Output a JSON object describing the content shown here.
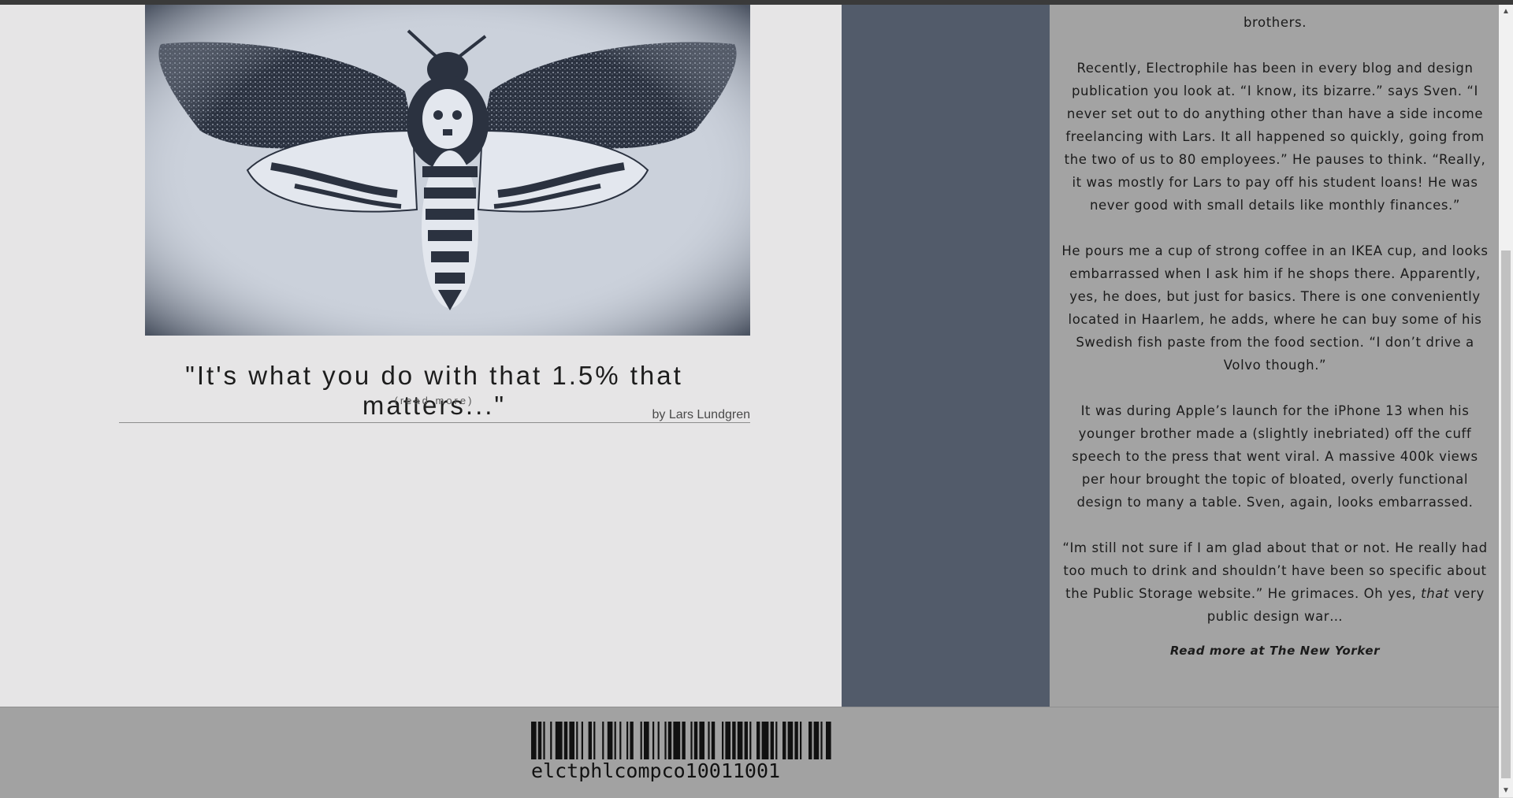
{
  "feature": {
    "quote": "\"It's what you do with that 1.5% that matters...\"",
    "read_more": "(read more)",
    "byline": "by Lars Lundgren"
  },
  "article": {
    "paragraphs": [
      "brothers.",
      "Recently, Electrophile has been in every blog and design publication you look at. “I know, its bizarre.” says Sven. “I never set out to do anything other than have a side income freelancing with Lars. It all happened so quickly, going from the two of us to 80 employees.” He pauses to think. “Really, it was mostly for Lars to pay off his student loans! He was never good with small details like monthly finances.”",
      "He pours me a cup of strong coffee in an IKEA cup, and looks embarrassed when I ask him if he shops there. Apparently, yes, he does, but just for basics. There is one conveniently located in Haarlem, he adds, where he can buy some of his Swedish fish paste from the food section. “I don’t drive a Volvo though.”",
      "It was during Apple’s launch for the iPhone 13 when his younger brother made a (slightly inebriated) off the cuff speech to the press that went viral. A massive 400k views per hour brought the topic of bloated, overly functional design to many a table. Sven, again, looks embarrassed."
    ],
    "last_paragraph": {
      "before_italic": "“Im still not sure if I am glad about that or not. He really had too much to drink and shouldn’t have been so specific about the Public Storage website.” He grimaces. Oh yes, ",
      "italic": "that",
      "after_italic": " very public design war…"
    },
    "read_more_link": "Read more at The New Yorker"
  },
  "footer": {
    "barcode_text": "elctphlcompco10011001"
  },
  "colors": {
    "left_panel_bg": "#e6e5e6",
    "slate_column": "#525b6a",
    "article_bg": "#a3a3a3",
    "footer_bg": "#a2a2a2",
    "moth_tint": "#cbd1db"
  },
  "icons": {
    "scroll_up": "▲",
    "scroll_down": "▼"
  }
}
